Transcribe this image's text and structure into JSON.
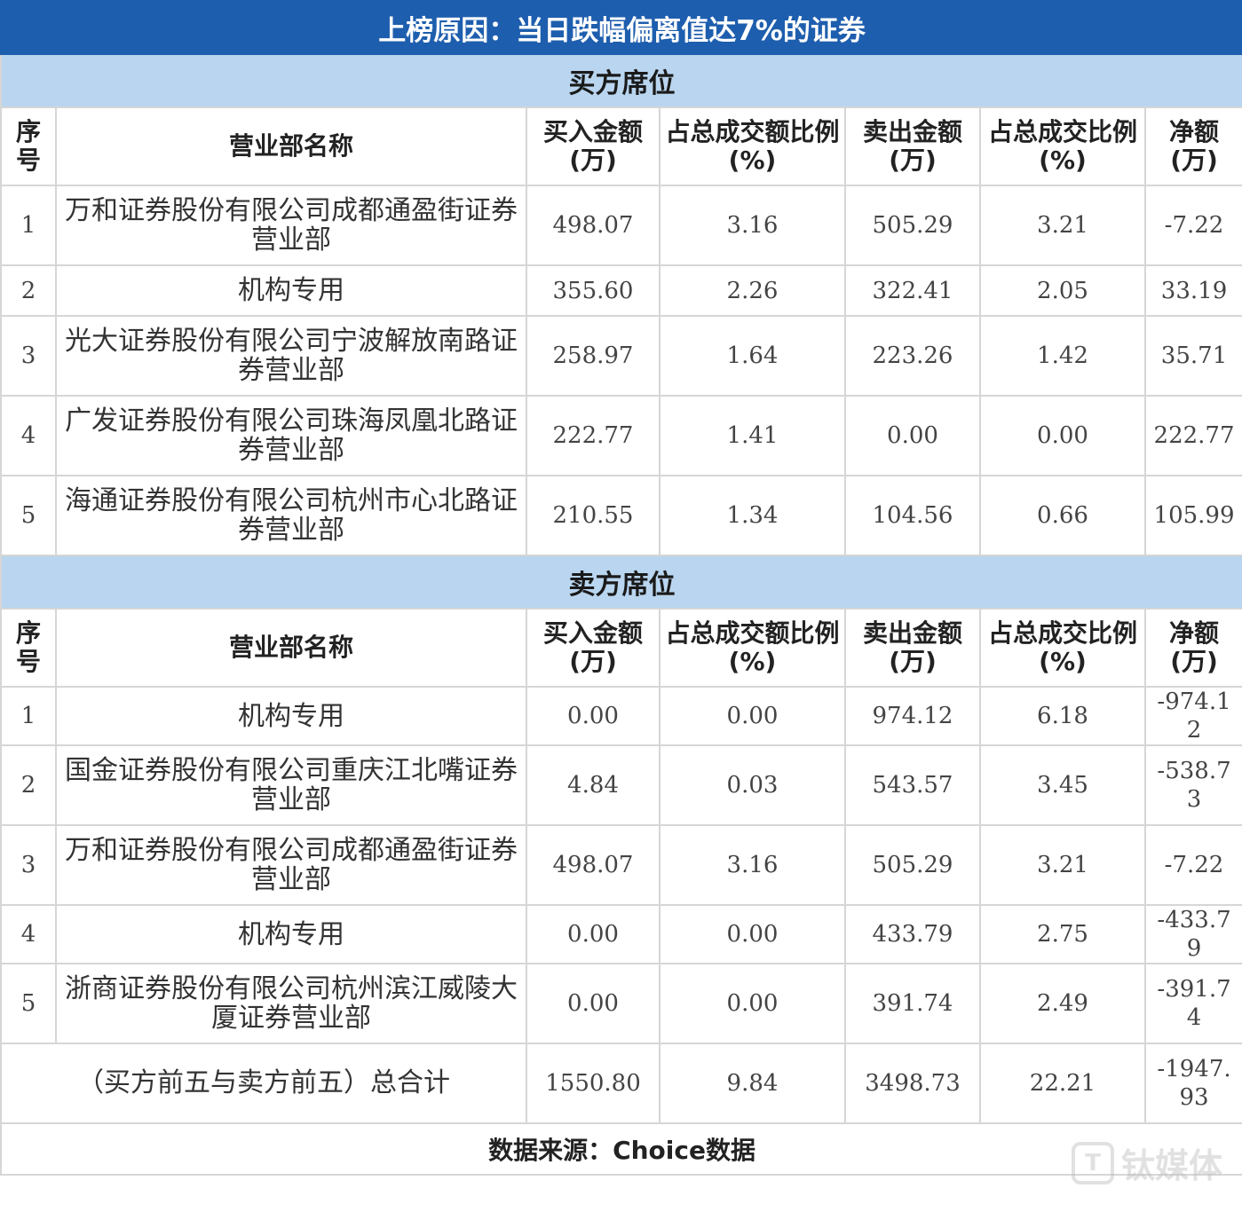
{
  "title": "上榜原因：当日跌幅偏离值达7%的证券",
  "columns": {
    "seq": "序号",
    "name": "营业部名称",
    "buy": "买入金额(万)",
    "buy_pct": "占总成交额比例(%)",
    "sell": "卖出金额(万)",
    "sell_pct": "占总成交比例(%)",
    "net": "净额(万)"
  },
  "buy_section": {
    "label": "买方席位",
    "rows": [
      {
        "seq": "1",
        "name": "万和证券股份有限公司成都通盈街证券营业部",
        "buy": "498.07",
        "buy_pct": "3.16",
        "sell": "505.29",
        "sell_pct": "3.21",
        "net": "-7.22"
      },
      {
        "seq": "2",
        "name": "机构专用",
        "buy": "355.60",
        "buy_pct": "2.26",
        "sell": "322.41",
        "sell_pct": "2.05",
        "net": "33.19"
      },
      {
        "seq": "3",
        "name": "光大证券股份有限公司宁波解放南路证券营业部",
        "buy": "258.97",
        "buy_pct": "1.64",
        "sell": "223.26",
        "sell_pct": "1.42",
        "net": "35.71"
      },
      {
        "seq": "4",
        "name": "广发证券股份有限公司珠海凤凰北路证券营业部",
        "buy": "222.77",
        "buy_pct": "1.41",
        "sell": "0.00",
        "sell_pct": "0.00",
        "net": "222.77"
      },
      {
        "seq": "5",
        "name": "海通证券股份有限公司杭州市心北路证券营业部",
        "buy": "210.55",
        "buy_pct": "1.34",
        "sell": "104.56",
        "sell_pct": "0.66",
        "net": "105.99"
      }
    ]
  },
  "sell_section": {
    "label": "卖方席位",
    "rows": [
      {
        "seq": "1",
        "name": "机构专用",
        "buy": "0.00",
        "buy_pct": "0.00",
        "sell": "974.12",
        "sell_pct": "6.18",
        "net": "-974.12"
      },
      {
        "seq": "2",
        "name": "国金证券股份有限公司重庆江北嘴证券营业部",
        "buy": "4.84",
        "buy_pct": "0.03",
        "sell": "543.57",
        "sell_pct": "3.45",
        "net": "-538.73"
      },
      {
        "seq": "3",
        "name": "万和证券股份有限公司成都通盈街证券营业部",
        "buy": "498.07",
        "buy_pct": "3.16",
        "sell": "505.29",
        "sell_pct": "3.21",
        "net": "-7.22"
      },
      {
        "seq": "4",
        "name": "机构专用",
        "buy": "0.00",
        "buy_pct": "0.00",
        "sell": "433.79",
        "sell_pct": "2.75",
        "net": "-433.79"
      },
      {
        "seq": "5",
        "name": "浙商证券股份有限公司杭州滨江威陵大厦证券营业部",
        "buy": "0.00",
        "buy_pct": "0.00",
        "sell": "391.74",
        "sell_pct": "2.49",
        "net": "-391.74"
      }
    ]
  },
  "total": {
    "label": "（买方前五与卖方前五）总合计",
    "buy": "1550.80",
    "buy_pct": "9.84",
    "sell": "3498.73",
    "sell_pct": "22.21",
    "net": "-1947.93"
  },
  "source": "数据来源：Choice数据",
  "watermark": {
    "text": "钛媒体",
    "logo": "T"
  }
}
